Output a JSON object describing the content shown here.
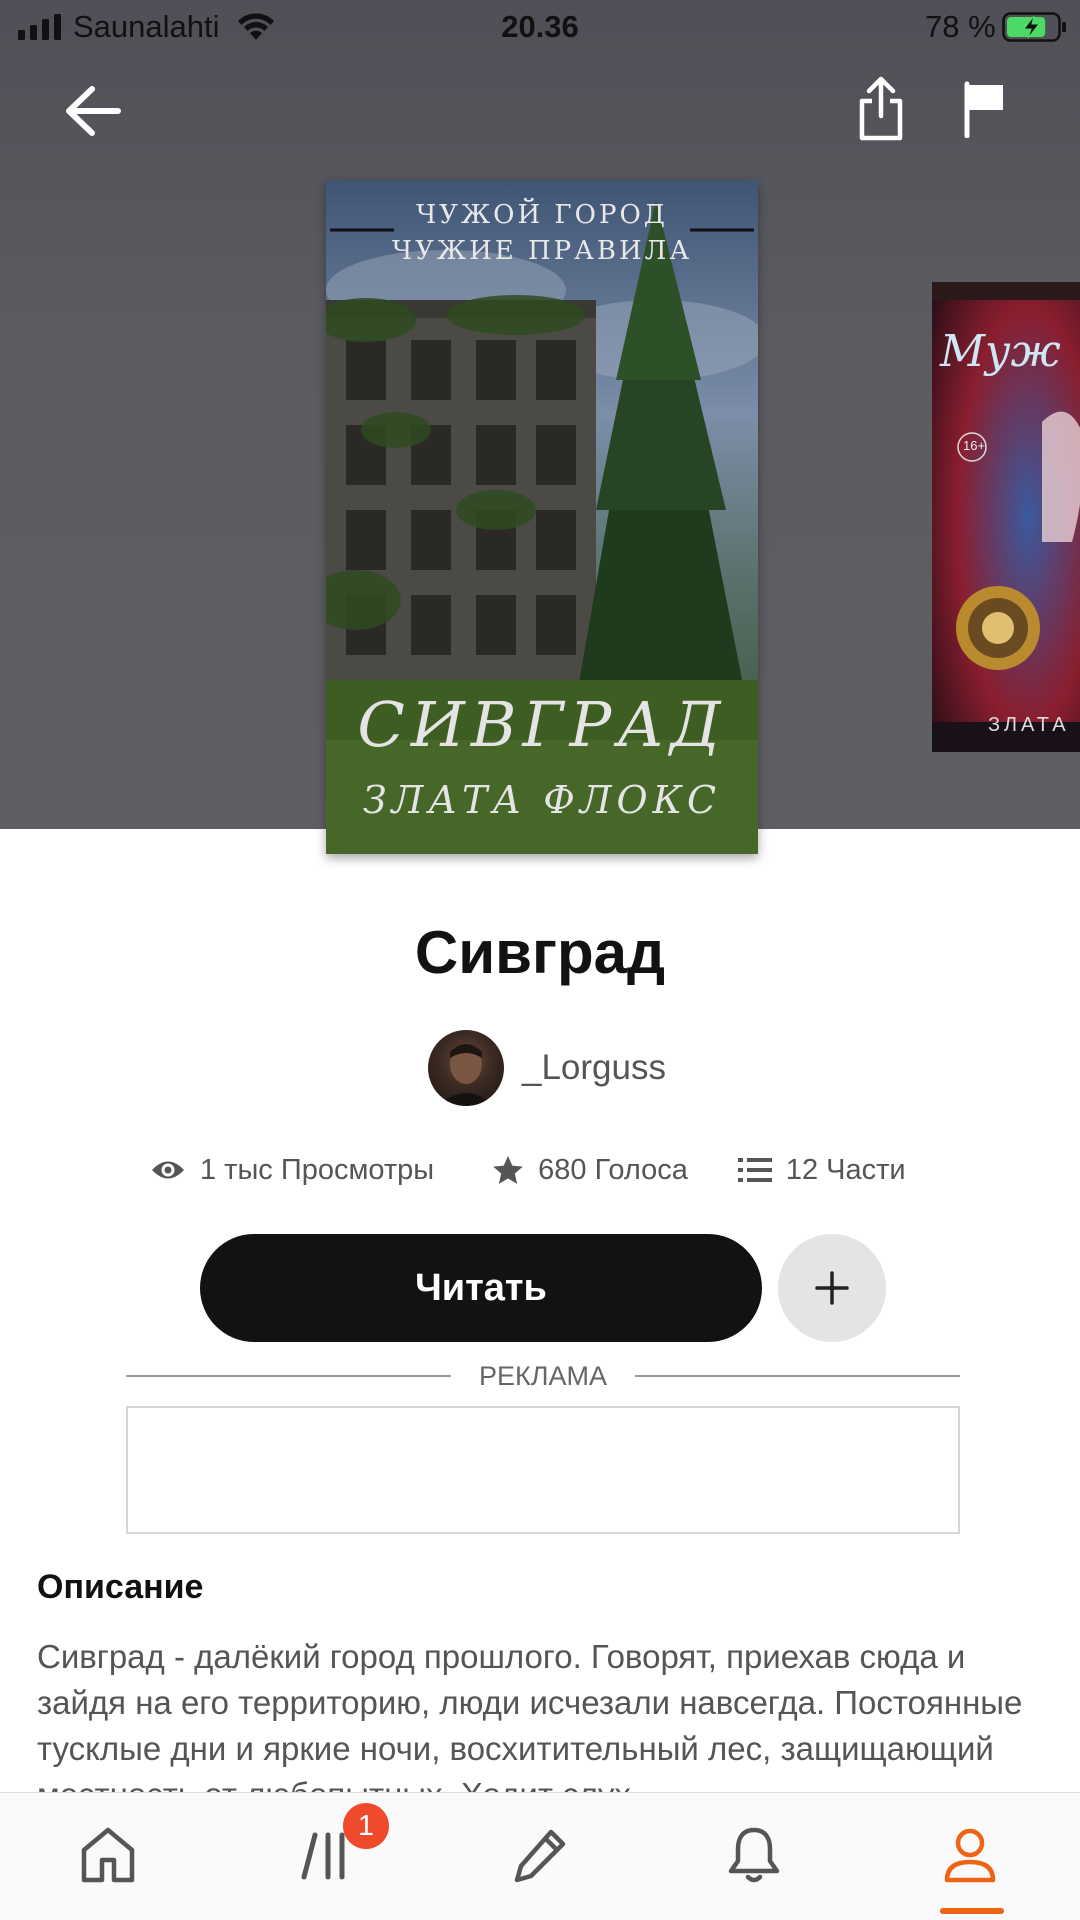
{
  "status_bar": {
    "carrier": "Saunalahti",
    "time": "20.36",
    "battery_percent": "78 %",
    "battery_level": 0.78
  },
  "header": {
    "back_icon": "arrow-left-icon",
    "share_icon": "share-icon",
    "report_icon": "flag-icon"
  },
  "cover": {
    "top_text_line1": "ЧУЖОЙ ГОРОД",
    "top_text_line2": "ЧУЖИЕ ПРАВИЛА",
    "cover_title": "СИВГРАД",
    "cover_author": "ЗЛАТА ФЛОКС"
  },
  "next_cover": {
    "title_fragment": "Муж",
    "age_badge": "16+",
    "author_fragment": "ЗЛАТА"
  },
  "story": {
    "title": "Сивград",
    "author": "_Lorguss",
    "views": "1 тыс Просмотры",
    "votes": "680 Голоса",
    "parts": "12 Части"
  },
  "actions": {
    "read_label": "Читать",
    "add_icon": "plus-icon"
  },
  "ad": {
    "label": "РЕКЛАМА"
  },
  "description": {
    "heading": "Описание",
    "text": "Сивград - далёкий город прошлого. Говорят, приехав сюда и зайдя на его территорию, люди исчезали навсегда. Постоянные тусклые дни и яркие ночи, восхитительный лес, защищающий местность от любопытных. Ходит слух"
  },
  "tabbar": {
    "tabs": [
      {
        "name": "home",
        "icon": "home-icon"
      },
      {
        "name": "library",
        "icon": "library-icon",
        "badge": "1"
      },
      {
        "name": "write",
        "icon": "pencil-icon"
      },
      {
        "name": "notifications",
        "icon": "bell-icon"
      },
      {
        "name": "profile",
        "icon": "profile-icon",
        "active": true
      }
    ],
    "accent_color": "#ee6414",
    "badge_color": "#f04a2c"
  }
}
